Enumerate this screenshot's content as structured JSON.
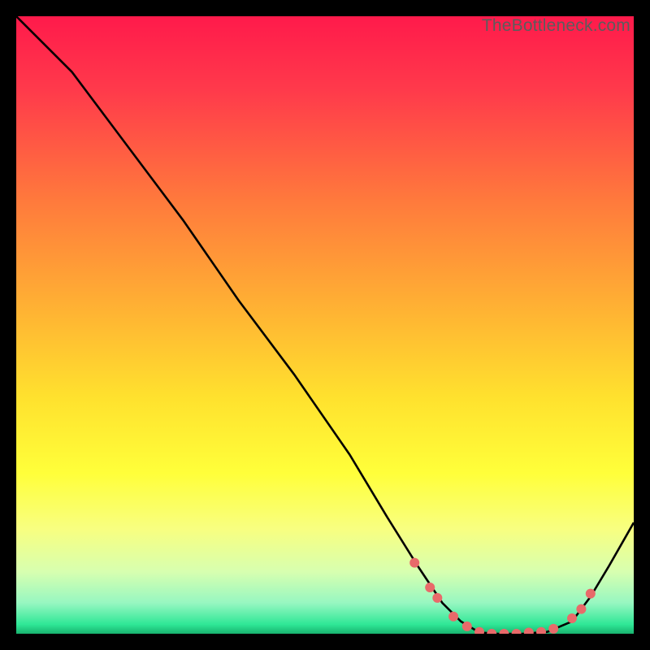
{
  "watermark": "TheBottleneck.com",
  "chart_data": {
    "type": "line",
    "title": "",
    "xlabel": "",
    "ylabel": "",
    "xlim": [
      0,
      100
    ],
    "ylim": [
      0,
      100
    ],
    "grid": false,
    "background_gradient_stops": [
      {
        "offset": 0.0,
        "color": "#ff1a4b"
      },
      {
        "offset": 0.12,
        "color": "#ff3a4b"
      },
      {
        "offset": 0.3,
        "color": "#ff7a3c"
      },
      {
        "offset": 0.48,
        "color": "#ffb433"
      },
      {
        "offset": 0.62,
        "color": "#ffe22e"
      },
      {
        "offset": 0.74,
        "color": "#ffff3a"
      },
      {
        "offset": 0.83,
        "color": "#f8ff80"
      },
      {
        "offset": 0.9,
        "color": "#d7ffb0"
      },
      {
        "offset": 0.95,
        "color": "#97f7c1"
      },
      {
        "offset": 0.985,
        "color": "#2fe796"
      },
      {
        "offset": 1.0,
        "color": "#18b36e"
      }
    ],
    "series": [
      {
        "name": "bottleneck-curve",
        "color": "#000000",
        "x": [
          0,
          4.5,
          9,
          18,
          27,
          36,
          45,
          54,
          60,
          65,
          69,
          72,
          75,
          78,
          82,
          86,
          90,
          93,
          96,
          100
        ],
        "y": [
          100,
          95.5,
          91,
          79,
          67,
          54,
          42,
          29,
          19,
          11,
          5,
          2,
          0.2,
          0,
          0,
          0.3,
          2,
          6,
          11,
          18
        ]
      }
    ],
    "markers": {
      "name": "highlight-points",
      "color": "#e86a6a",
      "radius": 6,
      "points": [
        {
          "x": 64.5,
          "y": 11.5
        },
        {
          "x": 67.0,
          "y": 7.5
        },
        {
          "x": 68.2,
          "y": 5.8
        },
        {
          "x": 70.8,
          "y": 2.8
        },
        {
          "x": 73.0,
          "y": 1.2
        },
        {
          "x": 75.0,
          "y": 0.3
        },
        {
          "x": 77.0,
          "y": 0.0
        },
        {
          "x": 79.0,
          "y": 0.0
        },
        {
          "x": 81.0,
          "y": 0.0
        },
        {
          "x": 83.0,
          "y": 0.2
        },
        {
          "x": 85.0,
          "y": 0.3
        },
        {
          "x": 87.0,
          "y": 0.8
        },
        {
          "x": 90.0,
          "y": 2.5
        },
        {
          "x": 91.5,
          "y": 4.0
        },
        {
          "x": 93.0,
          "y": 6.5
        }
      ]
    }
  }
}
